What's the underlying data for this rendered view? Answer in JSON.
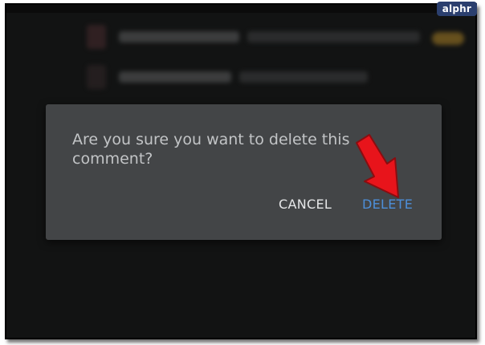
{
  "watermark": {
    "text": "alphr"
  },
  "dialog": {
    "message": "Are you sure you want to delete this comment?",
    "cancel_label": "CANCEL",
    "delete_label": "DELETE"
  },
  "colors": {
    "dialog_background": "#434547",
    "screen_background": "#121313",
    "delete_accent": "#4d8fd9",
    "arrow_annotation": "#e8141b"
  },
  "annotation": {
    "arrow_icon": "red-arrow-pointing-to-delete"
  }
}
